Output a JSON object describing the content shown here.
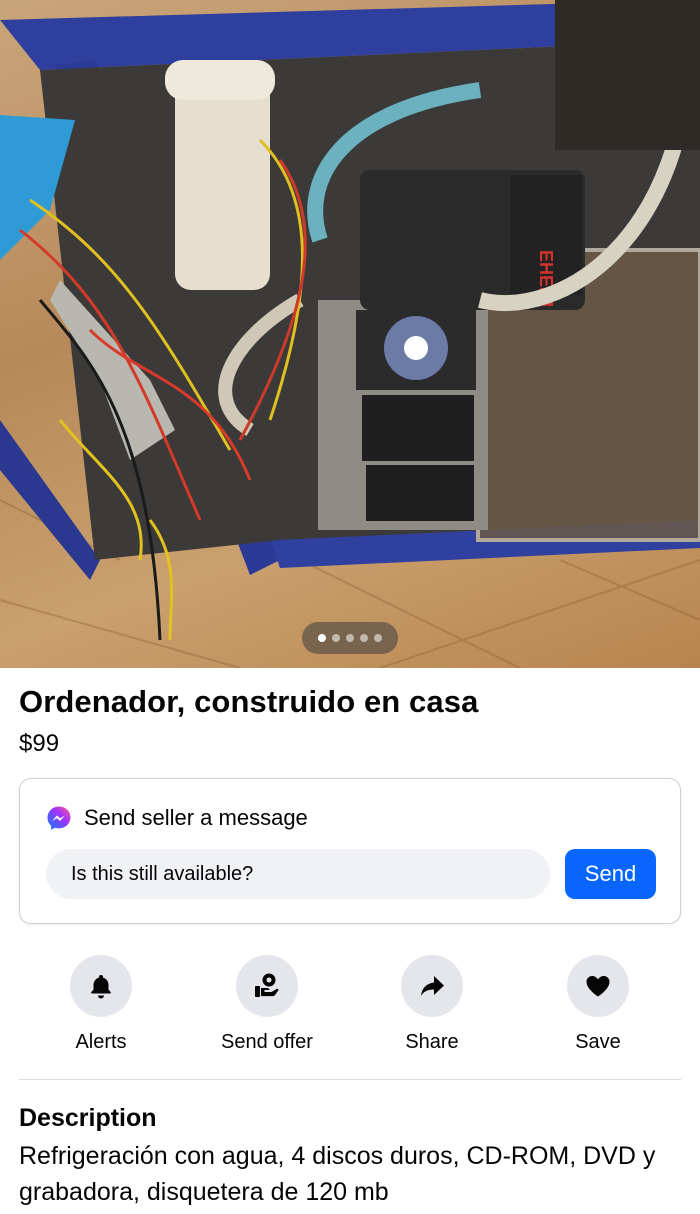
{
  "listing": {
    "title": "Ordenador, construido en casa",
    "price": "$99",
    "photo": {
      "image_count": 5,
      "active_index": 0,
      "fan_label": "EHEIM"
    }
  },
  "message": {
    "heading": "Send seller a message",
    "input_value": "Is this still available?",
    "send_label": "Send"
  },
  "actions": [
    {
      "label": "Alerts",
      "icon": "bell-icon"
    },
    {
      "label": "Send offer",
      "icon": "offer-icon"
    },
    {
      "label": "Share",
      "icon": "share-icon"
    },
    {
      "label": "Save",
      "icon": "heart-icon"
    }
  ],
  "description": {
    "heading": "Description",
    "text": "Refrigeración con agua, 4 discos duros, CD-ROM, DVD y grabadora, disquetera de 120 mb"
  },
  "colors": {
    "accent": "#0866ff",
    "text": "#050505",
    "chip": "#e4e6eb",
    "input_bg": "#f0f2f5"
  }
}
